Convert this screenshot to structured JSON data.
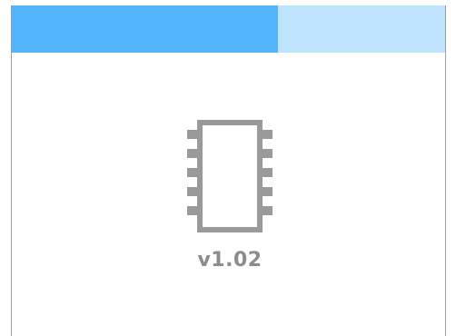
{
  "progress": {
    "fraction": 0.615,
    "fill_color": "#52b4fb",
    "track_color": "#bde3fd"
  },
  "device": {
    "icon": "chip-icon",
    "version": "v1.02",
    "text_color": "#8c8c8c"
  }
}
